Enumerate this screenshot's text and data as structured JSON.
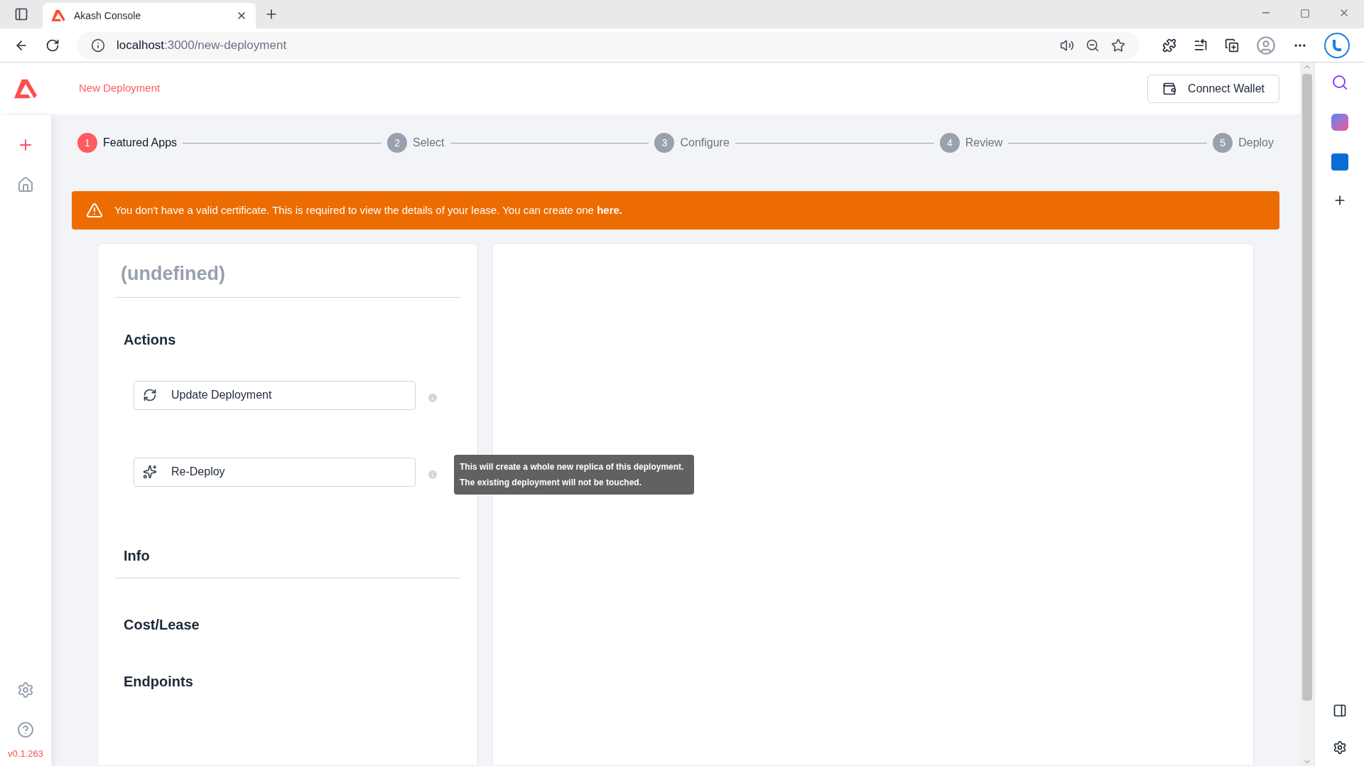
{
  "browser": {
    "tab_title": "Akash Console",
    "url_host": "localhost",
    "url_path": ":3000/new-deployment"
  },
  "header": {
    "title": "New Deployment",
    "connect_wallet": "Connect Wallet"
  },
  "nav": {
    "version": "v0.1.263"
  },
  "steps": [
    {
      "number": "1",
      "label": "Featured Apps",
      "selected": true
    },
    {
      "number": "2",
      "label": "Select",
      "selected": false
    },
    {
      "number": "3",
      "label": "Configure",
      "selected": false
    },
    {
      "number": "4",
      "label": "Review",
      "selected": false
    },
    {
      "number": "5",
      "label": "Deploy",
      "selected": false
    }
  ],
  "alert": {
    "text": "You don't have a valid certificate. This is required to view the details of your lease. You can create one",
    "link": "here."
  },
  "card": {
    "title": "(undefined)",
    "actions_heading": "Actions",
    "actions": [
      {
        "label": "Update Deployment",
        "kind": "update"
      },
      {
        "label": "Re-Deploy",
        "kind": "redeploy"
      }
    ],
    "tooltip": [
      "This will create a whole new replica of this deployment.",
      "The existing deployment will not be touched."
    ],
    "sections": [
      {
        "title": "Info",
        "divider": true
      },
      {
        "title": "Cost/Lease",
        "divider": false
      },
      {
        "title": "Endpoints",
        "divider": false
      }
    ]
  }
}
